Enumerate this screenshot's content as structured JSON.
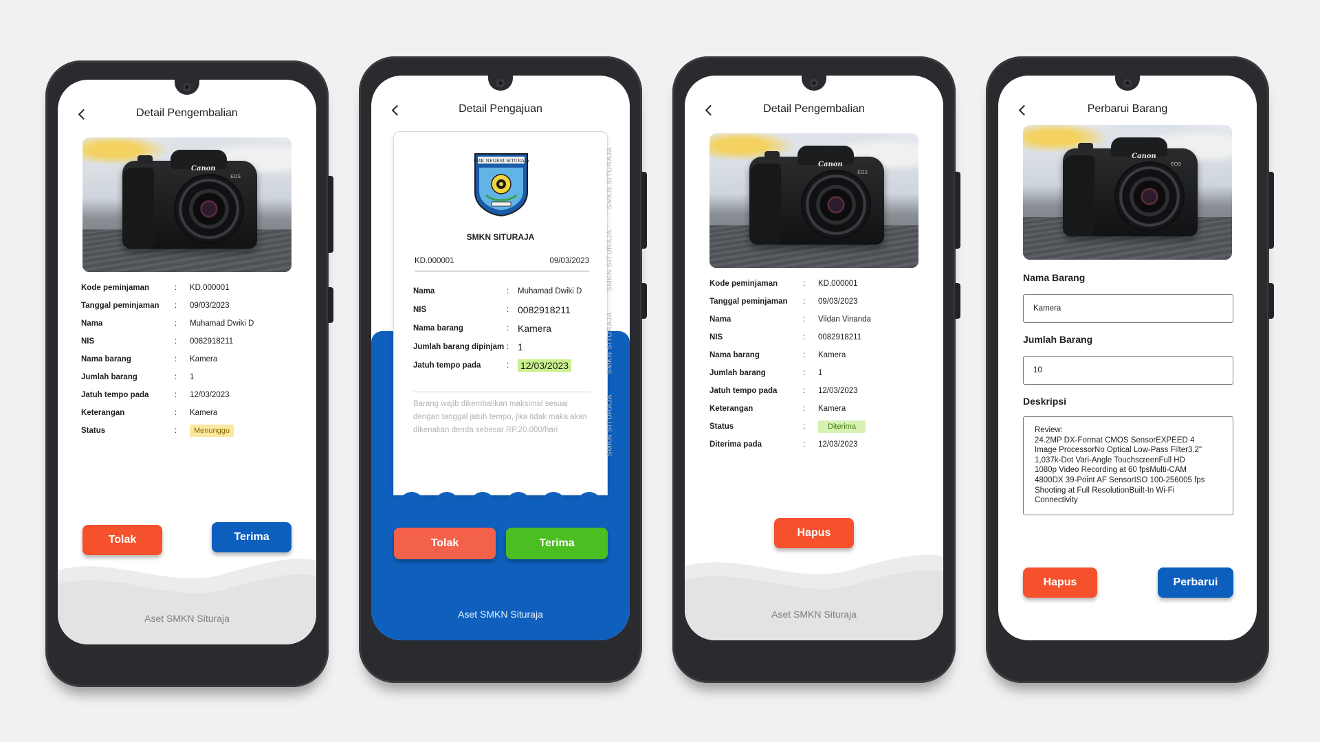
{
  "brand_colors": {
    "red": "#f4512c",
    "blue": "#0d5fbd",
    "green": "#4bbf22",
    "status_waiting": "#fbe89f",
    "status_accepted": "#d6f1b3"
  },
  "screens": [
    {
      "title": "Detail Pengembalian",
      "back_icon": "chevron-left-icon",
      "rows": [
        {
          "label": "Kode peminjaman",
          "value": "KD.000001"
        },
        {
          "label": "Tanggal peminjaman",
          "value": "09/03/2023"
        },
        {
          "label": "Nama",
          "value": "Muhamad Dwiki D"
        },
        {
          "label": "NIS",
          "value": "0082918211"
        },
        {
          "label": "Nama barang",
          "value": "Kamera"
        },
        {
          "label": "Jumlah barang",
          "value": "1"
        },
        {
          "label": "Jatuh tempo pada",
          "value": "12/03/2023"
        },
        {
          "label": "Keterangan",
          "value": "Kamera"
        },
        {
          "label": "Status",
          "value": "Menunggu"
        }
      ],
      "reject_label": "Tolak",
      "accept_label": "Terima",
      "footer": "Aset SMKN Situraja"
    },
    {
      "title": "Detail Pengajuan",
      "back_icon": "chevron-left-icon",
      "logo_text": "SMK NEGERI SITURAJA",
      "school_name": "SMKN SITURAJA",
      "code": "KD.000001",
      "date": "09/03/2023",
      "rows": [
        {
          "label": "Nama",
          "value": "Muhamad Dwiki D"
        },
        {
          "label": "NIS",
          "value": "0082918211"
        },
        {
          "label": "Nama barang",
          "value": "Kamera"
        },
        {
          "label": "Jumlah barang dipinjam",
          "value": "1"
        },
        {
          "label": "Jatuh tempo pada",
          "value": "12/03/2023"
        }
      ],
      "note": "Barang wajib dikembalikan maksimal sesuai dengan tanggal jatuh tempo, jika tidak maka akan dikenakan denda sebesar RP.20.000/hari",
      "watermark": "SMKN SITURAJA",
      "reject_label": "Tolak",
      "accept_label": "Terima",
      "footer": "Aset SMKN Situraja"
    },
    {
      "title": "Detail Pengembalian",
      "back_icon": "chevron-left-icon",
      "rows": [
        {
          "label": "Kode peminjaman",
          "value": "KD.000001"
        },
        {
          "label": "Tanggal peminjaman",
          "value": "09/03/2023"
        },
        {
          "label": "Nama",
          "value": "Vildan Vinanda"
        },
        {
          "label": "NIS",
          "value": "0082918211"
        },
        {
          "label": "Nama barang",
          "value": "Kamera"
        },
        {
          "label": "Jumlah barang",
          "value": "1"
        },
        {
          "label": "Jatuh tempo pada",
          "value": "12/03/2023"
        },
        {
          "label": "Keterangan",
          "value": "Kamera"
        },
        {
          "label": "Status",
          "value": "Diterima"
        },
        {
          "label": "Diterima pada",
          "value": "12/03/2023"
        }
      ],
      "delete_label": "Hapus",
      "footer": "Aset SMKN Situraja"
    },
    {
      "title": "Perbarui Barang",
      "back_icon": "chevron-left-icon",
      "name_label": "Nama Barang",
      "name_value": "Kamera",
      "qty_label": "Jumlah Barang",
      "qty_value": "10",
      "desc_label": "Deskripsi",
      "desc_value": "Review:\n24.2MP DX-Format CMOS SensorEXPEED 4\nImage ProcessorNo Optical Low-Pass Filter3.2\"\n1,037k-Dot Vari-Angle TouchscreenFull HD\n1080p Video Recording at 60 fpsMulti-CAM\n4800DX 39-Point AF SensorISO 100-256005 fps\nShooting at Full ResolutionBuilt-In Wi-Fi\nConnectivity",
      "delete_label": "Hapus",
      "update_label": "Perbarui"
    }
  ],
  "camera_image": {
    "brand": "Canon",
    "model": "EOS",
    "model_letter": "R"
  }
}
